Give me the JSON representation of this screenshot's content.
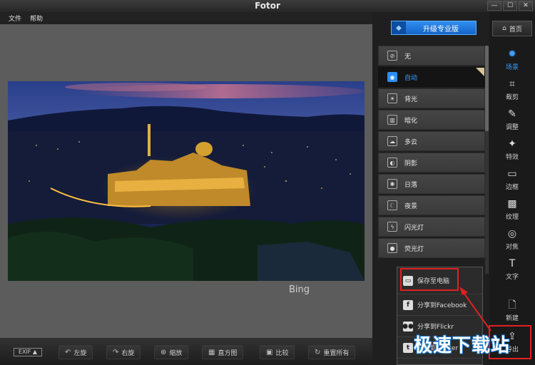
{
  "window": {
    "title": "Fotor",
    "min_label": "—",
    "max_label": "☐",
    "close_label": "✕"
  },
  "menu": {
    "file": "文件",
    "help": "帮助"
  },
  "photo": {
    "watermark": "Bing"
  },
  "bottom": {
    "exif": "EXIF ▲",
    "tools": [
      {
        "label": "左旋",
        "icon": "rotate-left-icon",
        "glyph": "↶"
      },
      {
        "label": "右旋",
        "icon": "rotate-right-icon",
        "glyph": "↷"
      },
      {
        "label": "缩放",
        "icon": "zoom-icon",
        "glyph": "⊕"
      },
      {
        "label": "直方图",
        "icon": "histogram-icon",
        "glyph": "▦"
      },
      {
        "label": "比较",
        "icon": "compare-icon",
        "glyph": "▣"
      },
      {
        "label": "重置所有",
        "icon": "reset-icon",
        "glyph": "↻"
      }
    ]
  },
  "panel": {
    "upgrade_label": "升级专业版",
    "scenes": [
      {
        "label": "无",
        "icon": "none-icon",
        "glyph": "⊘"
      },
      {
        "label": "自动",
        "icon": "camera-icon",
        "glyph": "◉",
        "active": true
      },
      {
        "label": "背光",
        "icon": "backlight-icon",
        "glyph": "☀"
      },
      {
        "label": "暗化",
        "icon": "darken-icon",
        "glyph": "▥"
      },
      {
        "label": "多云",
        "icon": "cloud-icon",
        "glyph": "☁"
      },
      {
        "label": "阴影",
        "icon": "shadow-icon",
        "glyph": "◐"
      },
      {
        "label": "日落",
        "icon": "sunset-icon",
        "glyph": "✺"
      },
      {
        "label": "夜景",
        "icon": "moon-icon",
        "glyph": "☾"
      },
      {
        "label": "闪光灯",
        "icon": "flash-icon",
        "glyph": "ϟ"
      },
      {
        "label": "荧光灯",
        "icon": "bulb-icon",
        "glyph": "●"
      }
    ]
  },
  "nav": {
    "home": "首页",
    "items": [
      {
        "label": "场景",
        "icon": "scene-icon",
        "glyph": "✹",
        "active": true
      },
      {
        "label": "裁剪",
        "icon": "crop-icon",
        "glyph": "⌗"
      },
      {
        "label": "调整",
        "icon": "pencil-icon",
        "glyph": "✎"
      },
      {
        "label": "特效",
        "icon": "sparkle-icon",
        "glyph": "✦"
      },
      {
        "label": "边框",
        "icon": "frame-icon",
        "glyph": "▭"
      },
      {
        "label": "纹理",
        "icon": "texture-icon",
        "glyph": "▩"
      },
      {
        "label": "对焦",
        "icon": "focus-icon",
        "glyph": "◎"
      },
      {
        "label": "文字",
        "icon": "text-icon",
        "glyph": "T"
      }
    ],
    "new_label": "新建",
    "export_label": "导出"
  },
  "popup": {
    "items": [
      {
        "label": "保存至电脑",
        "icon": "monitor-icon",
        "glyph": "▭"
      },
      {
        "label": "分享到Facebook",
        "icon": "facebook-icon",
        "glyph": "f"
      },
      {
        "label": "分享到Flickr",
        "icon": "flickr-icon",
        "glyph": "●●"
      },
      {
        "label": "分享到Twitter",
        "icon": "twitter-icon",
        "glyph": "t"
      }
    ]
  },
  "site_watermark": "极速下载站"
}
